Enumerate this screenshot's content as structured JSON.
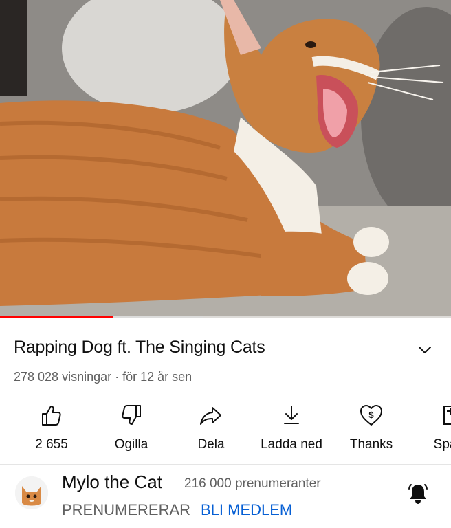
{
  "video": {
    "progress_played": 0.25,
    "progress_buffered": 0.45
  },
  "details": {
    "title": "Rapping Dog ft. The Singing Cats",
    "meta": "278 028 visningar · för 12 år sen"
  },
  "actions": [
    {
      "icon": "thumbs-up-icon",
      "label": "2 655"
    },
    {
      "icon": "thumbs-down-icon",
      "label": "Ogilla"
    },
    {
      "icon": "share-icon",
      "label": "Dela"
    },
    {
      "icon": "download-icon",
      "label": "Ladda ned"
    },
    {
      "icon": "thanks-heart-icon",
      "label": "Thanks"
    },
    {
      "icon": "save-icon",
      "label": "Spara"
    }
  ],
  "channel": {
    "name": "Mylo the Cat",
    "subscribers": "216 000 prenumeranter",
    "subscribed_label": "PRENUMERERAR",
    "join_label": "BLI MEDLEM"
  },
  "colors": {
    "progress": "#ff0000",
    "join_link": "#065fd4",
    "secondary_text": "#606060"
  }
}
